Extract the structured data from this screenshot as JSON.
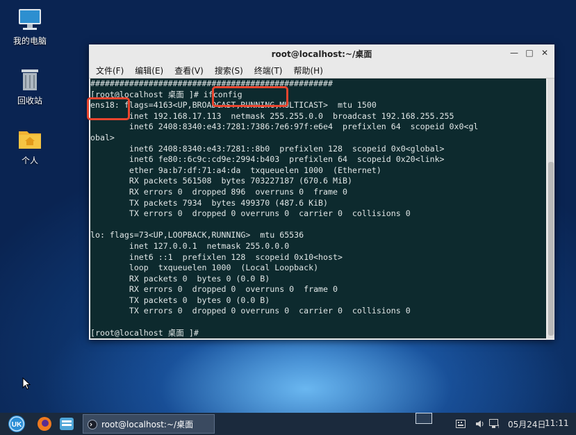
{
  "desktop": {
    "icons": [
      {
        "label": "我的电脑",
        "icon": "computer-icon"
      },
      {
        "label": "回收站",
        "icon": "trash-icon"
      },
      {
        "label": "个人",
        "icon": "home-folder-icon"
      }
    ]
  },
  "window": {
    "title": "root@localhost:~/桌面",
    "menu": [
      "文件(F)",
      "编辑(E)",
      "查看(V)",
      "搜索(S)",
      "终端(T)",
      "帮助(H)"
    ],
    "terminal_text": "##################################################\n[root@localhost 桌面 ]# ifconfig\nens18: flags=4163<UP,BROADCAST,RUNNING,MULTICAST>  mtu 1500\n        inet 192.168.17.113  netmask 255.255.0.0  broadcast 192.168.255.255\n        inet6 2408:8340:e43:7281:7386:7e6:97f:e6e4  prefixlen 64  scopeid 0x0<gl\nobal>\n        inet6 2408:8340:e43:7281::8b0  prefixlen 128  scopeid 0x0<global>\n        inet6 fe80::6c9c:cd9e:2994:b403  prefixlen 64  scopeid 0x20<link>\n        ether 9a:b7:df:71:a4:da  txqueuelen 1000  (Ethernet)\n        RX packets 561508  bytes 703227187 (670.6 MiB)\n        RX errors 0  dropped 896  overruns 0  frame 0\n        TX packets 7934  bytes 499370 (487.6 KiB)\n        TX errors 0  dropped 0 overruns 0  carrier 0  collisions 0\n\nlo: flags=73<UP,LOOPBACK,RUNNING>  mtu 65536\n        inet 127.0.0.1  netmask 255.0.0.0\n        inet6 ::1  prefixlen 128  scopeid 0x10<host>\n        loop  txqueuelen 1000  (Local Loopback)\n        RX packets 0  bytes 0 (0.0 B)\n        RX errors 0  dropped 0  overruns 0  frame 0\n        TX packets 0  bytes 0 (0.0 B)\n        TX errors 0  dropped 0 overruns 0  carrier 0  collisions 0\n\n[root@localhost 桌面 ]#",
    "highlight_color": "#e9452e"
  },
  "taskbar": {
    "task_label": "root@localhost:~/桌面",
    "date": "05月24日",
    "time": "11:11"
  }
}
